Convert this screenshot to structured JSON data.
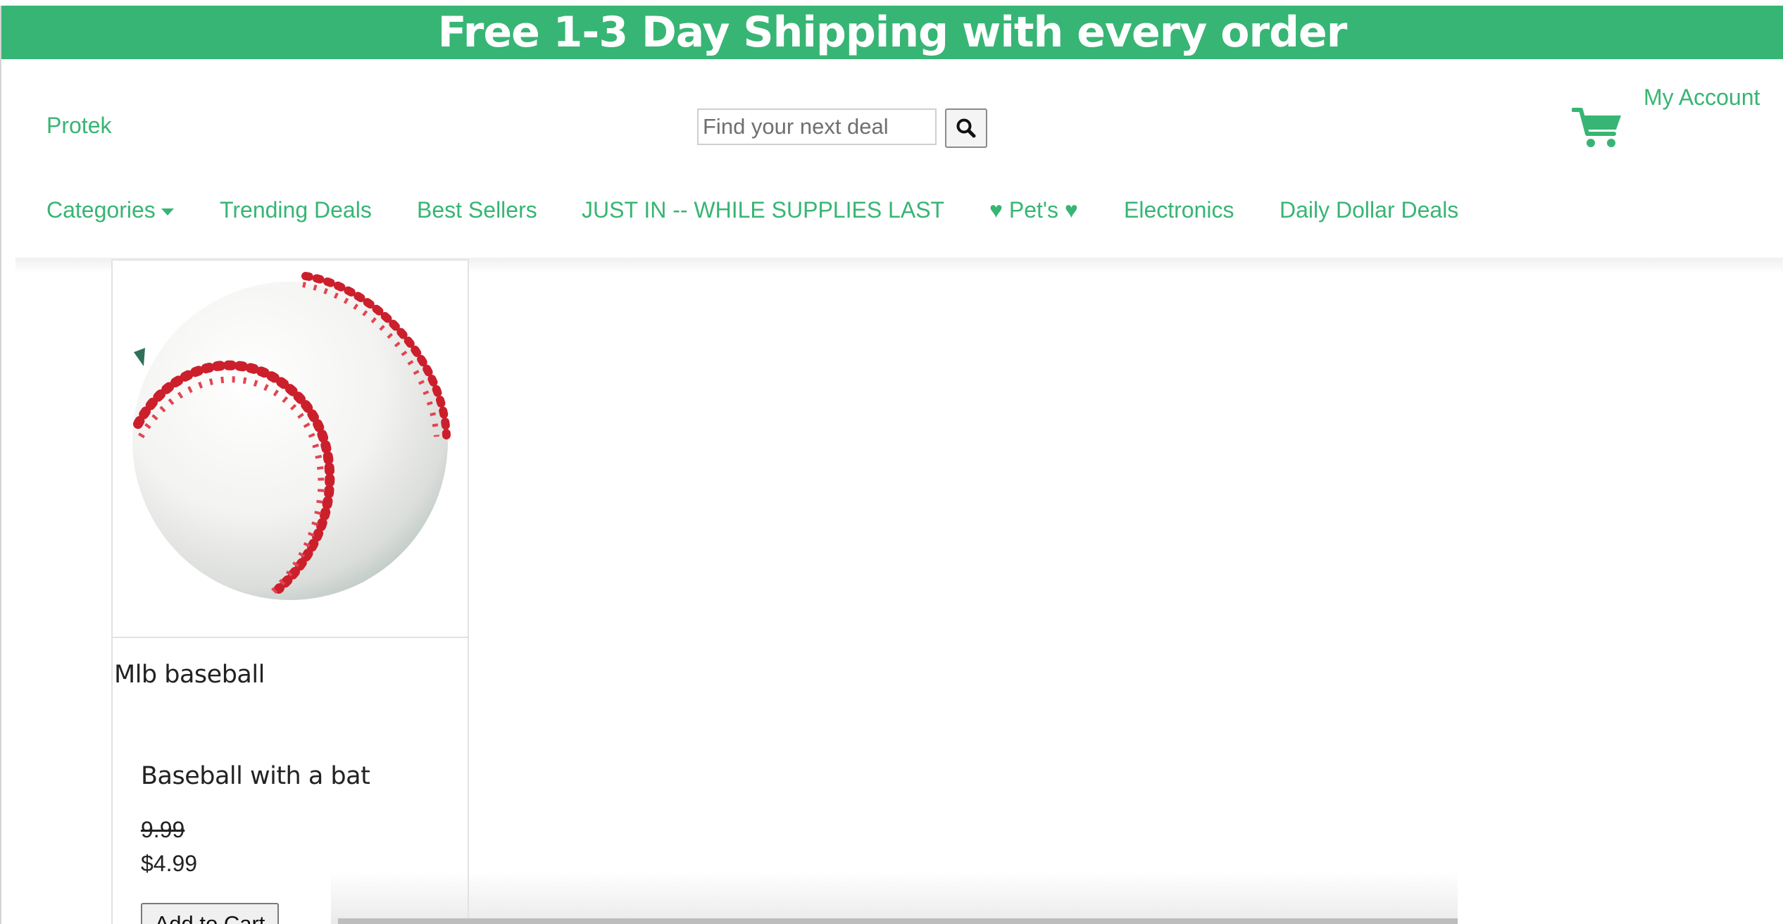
{
  "banner": {
    "text": "Free 1-3 Day Shipping with every order"
  },
  "header": {
    "brand": "Protek",
    "search": {
      "placeholder": "Find your next deal",
      "value": ""
    },
    "search_button_icon": "search-icon",
    "cart_icon": "cart-icon",
    "account_link": "My Account"
  },
  "nav": {
    "items": [
      {
        "label": "Categories",
        "has_dropdown": true
      },
      {
        "label": "Trending Deals"
      },
      {
        "label": "Best Sellers"
      },
      {
        "label": "JUST IN -- WHILE SUPPLIES LAST"
      },
      {
        "label": "♥ Pet's ♥"
      },
      {
        "label": "Electronics"
      },
      {
        "label": "Daily Dollar Deals"
      }
    ]
  },
  "product": {
    "image_icon": "baseball-image",
    "title": "Mlb baseball",
    "description": "Baseball with a bat",
    "original_price": "9.99",
    "sale_price": "$4.99",
    "add_to_cart_label": "Add to Cart"
  },
  "colors": {
    "brand_green": "#37b574",
    "stitch_red": "#cc1f2c"
  }
}
